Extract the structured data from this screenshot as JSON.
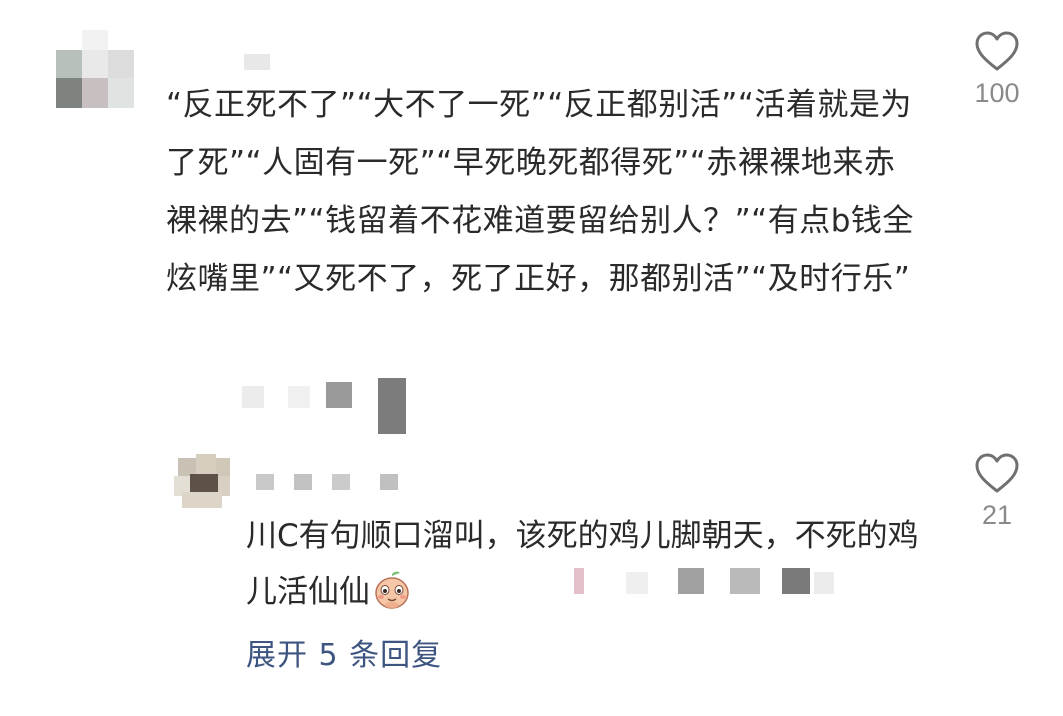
{
  "main_comment": {
    "text": "“反正死不了”“大不了一死”“反正都别活”“活着就是为了死”“人固有一死”“早死晚死都得死”“赤裸裸地来赤裸裸的去”“钱留着不花难道要留给别人？”“有点b钱全炫嘴里”“又死不了，死了正好，那都别活”“及时行乐”",
    "like_count": "100"
  },
  "reply": {
    "text": "川C有句顺口溜叫，该死的鸡儿脚朝天，不死的鸡儿活仙仙",
    "emoji_icon": "peach-face-icon",
    "like_count": "21"
  },
  "expand_replies": "展开 5 条回复",
  "colors": {
    "link": "#3d5580",
    "count": "#8a8a8a",
    "text": "#2a2a2a"
  }
}
